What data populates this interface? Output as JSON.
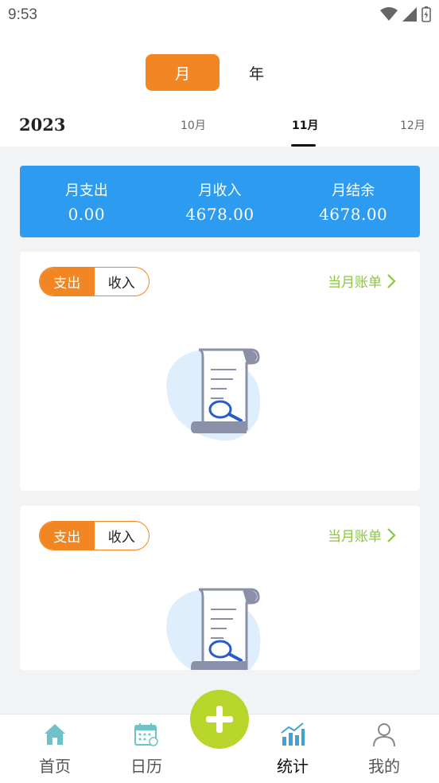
{
  "status": {
    "time": "9:53"
  },
  "period": {
    "month_label": "月",
    "year_label": "年"
  },
  "date_nav": {
    "year": "2023",
    "months": [
      "10月",
      "11月",
      "12月"
    ],
    "active_month": "11月"
  },
  "summary": [
    {
      "label": "月支出",
      "value": "0.00"
    },
    {
      "label": "月收入",
      "value": "4678.00"
    },
    {
      "label": "月结余",
      "value": "4678.00"
    }
  ],
  "cards": [
    {
      "segments": [
        "支出",
        "收入"
      ],
      "active": "支出",
      "bill_link": "当月账单"
    },
    {
      "segments": [
        "支出",
        "收入"
      ],
      "active": "支出",
      "bill_link": "当月账单"
    }
  ],
  "tabbar": {
    "items": [
      {
        "label": "首页",
        "icon": "home-icon"
      },
      {
        "label": "日历",
        "icon": "calendar-icon"
      },
      {
        "label": "统计",
        "icon": "chart-icon",
        "active": true
      },
      {
        "label": "我的",
        "icon": "user-icon"
      }
    ],
    "fab_icon": "plus-icon"
  },
  "colors": {
    "accent_orange": "#f28622",
    "summary_blue": "#2d9bf0",
    "link_green": "#8cc63f",
    "fab_green": "#b7d52b",
    "icon_teal": "#6fc3c8"
  }
}
